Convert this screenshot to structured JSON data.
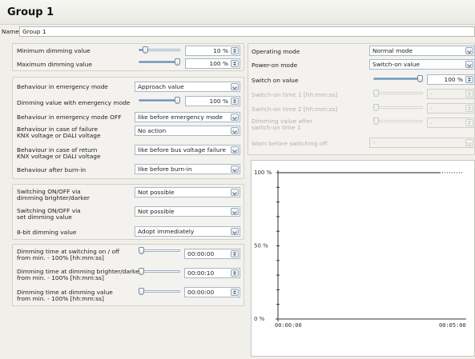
{
  "header": {
    "title": "Group 1"
  },
  "name_field": {
    "label": "Name",
    "value": "Group 1"
  },
  "dimming": {
    "min_label": "Minimum dimming value",
    "min_value": "10 %",
    "min_level": 0.1,
    "max_label": "Maximum dimming value",
    "max_value": "100 %",
    "max_level": 1.0
  },
  "emergency": {
    "behaviour_label": "Behaviour in emergency mode",
    "behaviour_value": "Approach value",
    "dim_label": "Dimming value with emergency mode",
    "dim_value": "100 %",
    "dim_level": 1.0,
    "off_label": "Behaviour in emergency mode OFF",
    "off_value": "like before emergency mode",
    "failure_label_1": "Behaviour in case of failure",
    "failure_label_2": "KNX voltage or DALI voltage",
    "failure_value": "No action",
    "return_label_1": "Behaviour in case of return",
    "return_label_2": "KNX voltage or DALI voltage",
    "return_value": "like before bus voltage failure",
    "burnin_label": "Behaviour after burn-in",
    "burnin_value": "like before burn-in"
  },
  "switching": {
    "brighter_label_1": "Switching ON/OFF via",
    "brighter_label_2": "dimming brighter/darker",
    "brighter_value": "Not possible",
    "setdim_label_1": "Switching ON/OFF via",
    "setdim_label_2": "set dimming value",
    "setdim_value": "Not possible",
    "bit8_label": "8-bit dimming value",
    "bit8_value": "Adopt immediately"
  },
  "timing": {
    "onoff_label_1": "Dimming time at switching on / off",
    "onoff_label_2": "from min. - 100% [hh:mm:ss]",
    "onoff_value": "00:00:00",
    "onoff_level": 0.0,
    "bright_label_1": "Dimming time at dimming brighter/darker",
    "bright_label_2": "from min. - 100% [hh:mm:ss]",
    "bright_value": "00:00:10",
    "bright_level": 0.0,
    "value_label_1": "Dimming time at dimming value",
    "value_label_2": "from min. - 100% [hh:mm:ss]",
    "value_value": "00:00:00",
    "value_level": 0.0
  },
  "operating": {
    "mode_label": "Operating mode",
    "mode_value": "Normal mode",
    "poweron_label": "Power-on mode",
    "poweron_value": "Switch-on value",
    "switchon_label": "Switch on value",
    "switchon_value": "100 %",
    "switchon_level": 1.0,
    "time1_label": "Switch-on time 1 [hh:mm:ss]",
    "time1_value": "-",
    "time2_label": "Switch-on time 2 [hh:mm:ss]",
    "time2_value": "-",
    "after_label_1": "Dimming value after",
    "after_label_2": "switch-on time 1",
    "after_value": "-",
    "warn_label": "Warn before switching off",
    "warn_value": "-"
  },
  "chart_data": {
    "type": "line",
    "y_tick_labels": [
      "100 %",
      "50 %",
      "0 %"
    ],
    "x_tick_labels": [
      "00:00:00",
      "00:00:00",
      "00:05:00"
    ],
    "ylim": [
      0,
      100
    ],
    "series": [
      {
        "values": [
          100,
          100,
          100
        ]
      }
    ]
  }
}
